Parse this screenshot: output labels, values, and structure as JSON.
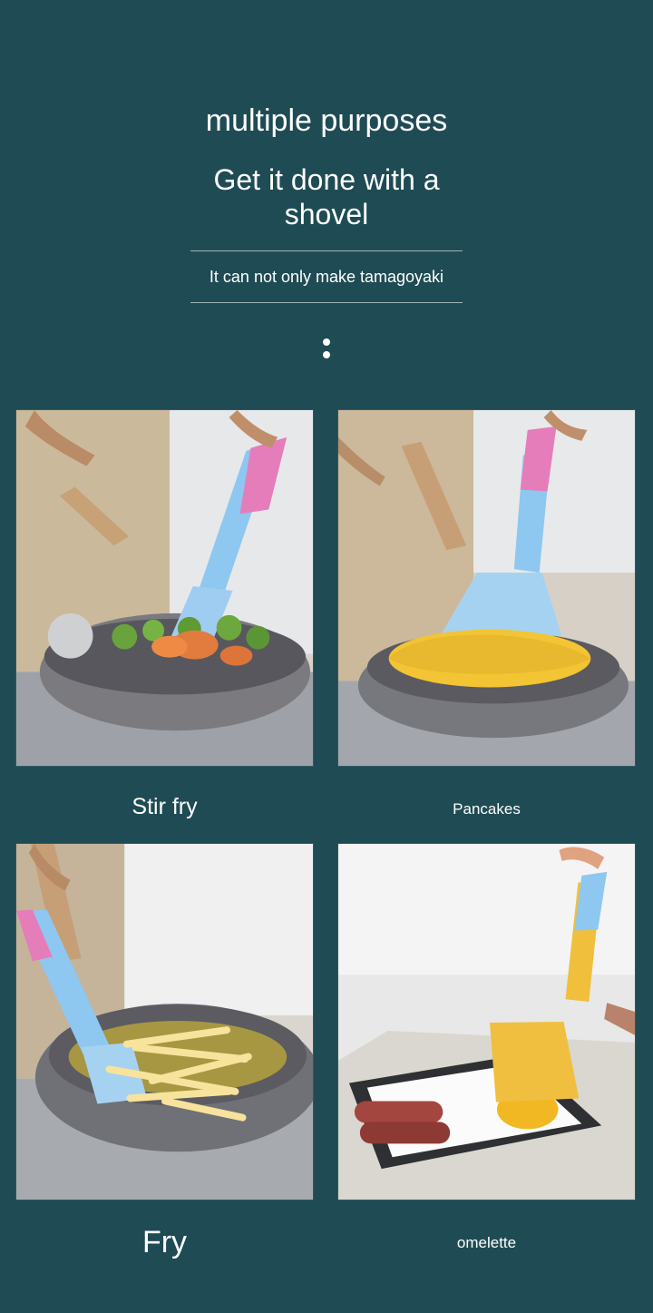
{
  "header": {
    "title": "multiple purposes",
    "subtitle": "Get it done with a shovel",
    "tagline": "It can not only make tamagoyaki"
  },
  "gallery": [
    {
      "caption": "Stir fry",
      "scene": "pan-with-vegetables"
    },
    {
      "caption": "Pancakes",
      "scene": "pan-with-pancake"
    },
    {
      "caption": "Fry",
      "scene": "pan-with-fries"
    },
    {
      "caption": "omelette",
      "scene": "square-pan-omelette"
    }
  ],
  "colors": {
    "background": "#1f4b54",
    "text": "#ffffff",
    "spatula_blue": "#8dc9ef",
    "spatula_pink": "#e37ab7",
    "spatula_yellow": "#f2c13c",
    "pan_gray": "#6e6f75",
    "pan_speckle": "#9aa0a8"
  }
}
